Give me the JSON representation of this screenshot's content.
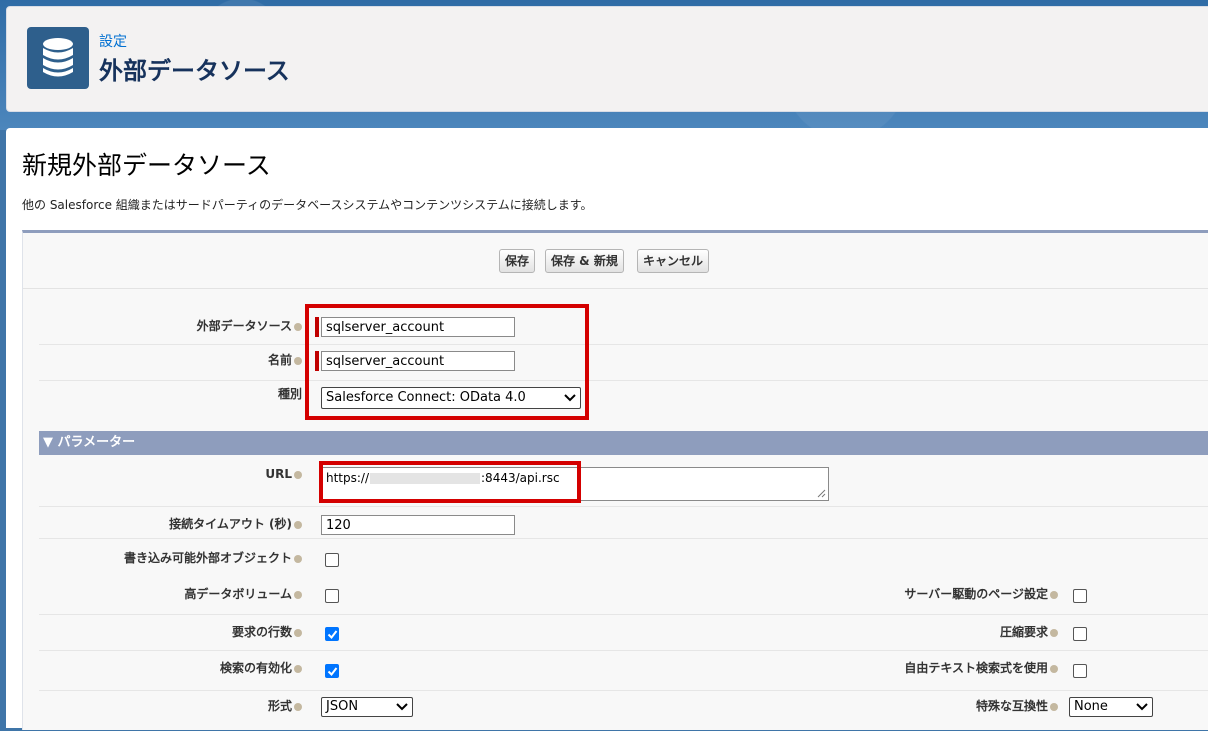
{
  "header": {
    "breadcrumb": "設定",
    "title": "外部データソース"
  },
  "page": {
    "title": "新規外部データソース",
    "description": "他の Salesforce 組織またはサードパーティのデータベースシステムやコンテンツシステムに接続します。"
  },
  "buttons": {
    "save": "保存",
    "save_new": "保存 & 新規",
    "cancel": "キャンセル"
  },
  "fields": {
    "external_data_source": {
      "label": "外部データソース",
      "value": "sqlserver_account"
    },
    "name": {
      "label": "名前",
      "value": "sqlserver_account"
    },
    "type": {
      "label": "種別",
      "value": "Salesforce Connect: OData 4.0"
    }
  },
  "parameters": {
    "section_title": "パラメーター",
    "url": {
      "label": "URL",
      "value_prefix": "https://",
      "value_suffix": ":8443/api.rsc"
    },
    "timeout": {
      "label": "接続タイムアウト (秒)",
      "value": "120"
    },
    "writable": {
      "label": "書き込み可能外部オブジェクト",
      "checked": false
    },
    "high_volume": {
      "label": "高データボリューム",
      "checked": false
    },
    "server_paging": {
      "label": "サーバー駆動のページ設定",
      "checked": false
    },
    "request_row_counts": {
      "label": "要求の行数",
      "checked": true
    },
    "compression": {
      "label": "圧縮要求",
      "checked": false
    },
    "enable_search": {
      "label": "検索の有効化",
      "checked": true
    },
    "free_text_search": {
      "label": "自由テキスト検索式を使用",
      "checked": false
    },
    "format": {
      "label": "形式",
      "value": "JSON"
    },
    "special_compat": {
      "label": "特殊な互換性",
      "value": "None"
    }
  },
  "colors": {
    "accent": "#0070d2",
    "highlight": "#d40000",
    "section_bar": "#8e9dbd"
  }
}
